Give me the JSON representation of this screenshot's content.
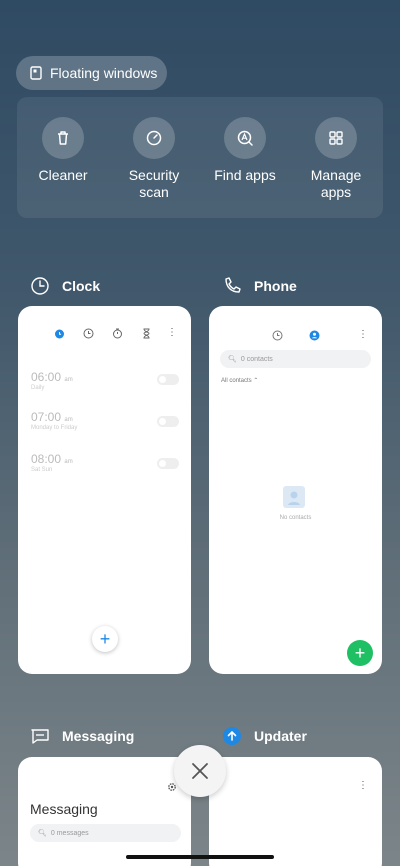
{
  "floating_windows": {
    "label": "Floating windows",
    "icon": "floating-window-icon"
  },
  "tools": [
    {
      "label": "Cleaner",
      "icon": "trash-icon"
    },
    {
      "label": "Security scan",
      "icon": "gauge-icon"
    },
    {
      "label": "Find apps",
      "icon": "search-app-icon"
    },
    {
      "label": "Manage apps",
      "icon": "grid-icon"
    }
  ],
  "apps": {
    "clock": {
      "title": "Clock",
      "alarms": [
        {
          "time": "06:00",
          "ampm": "am",
          "repeat": "Daily"
        },
        {
          "time": "07:00",
          "ampm": "am",
          "repeat": "Monday to Friday"
        },
        {
          "time": "08:00",
          "ampm": "am",
          "repeat": "Sat Sun"
        }
      ],
      "add": "+"
    },
    "phone": {
      "title": "Phone",
      "search_placeholder": "0 contacts",
      "filter": "All contacts",
      "empty": "No contacts",
      "add": "+"
    },
    "messaging": {
      "title": "Messaging",
      "heading": "Messaging",
      "search_placeholder": "0 messages"
    },
    "updater": {
      "title": "Updater"
    }
  },
  "colors": {
    "accent_blue": "#1e88e5",
    "fab_green": "#1fbf63"
  }
}
